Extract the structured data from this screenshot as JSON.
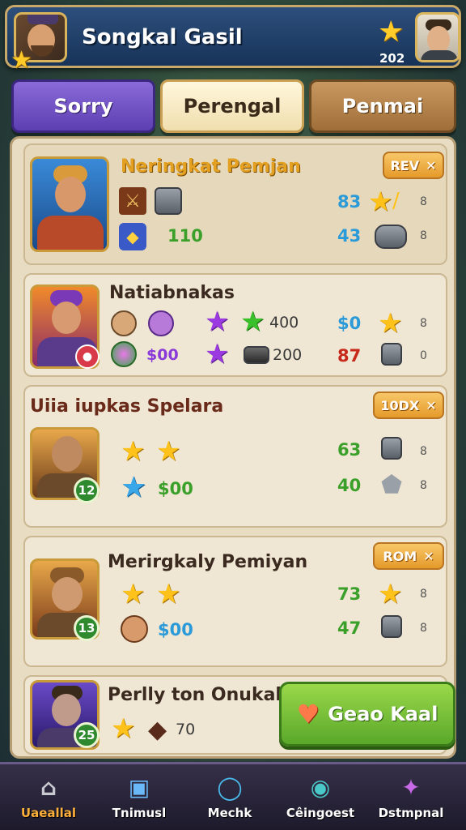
{
  "header": {
    "title": "Songkal Gasil",
    "star_count": "202",
    "star_icon": "star-icon"
  },
  "tabs": [
    {
      "label": "Sorry"
    },
    {
      "label": "Perengal"
    },
    {
      "label": "Penmai"
    }
  ],
  "cards": [
    {
      "title": "Neringkat Pemjan",
      "badge": "REV",
      "item_value": "110",
      "stats": [
        "83",
        "43"
      ],
      "side_values": [
        "8",
        "8"
      ]
    },
    {
      "title": "Natiabnakas",
      "values": [
        "400",
        "$00",
        "200"
      ],
      "stats": [
        "$0",
        "87"
      ],
      "side_values": [
        "8",
        "0"
      ]
    },
    {
      "title": "Uiia iupkas Spelara",
      "badge": "10DX",
      "level": "12",
      "value": "$00",
      "stats": [
        "63",
        "40"
      ],
      "side_values": [
        "8",
        "8"
      ]
    },
    {
      "title": "Merirgkaly Pemiyan",
      "badge": "ROM",
      "level": "13",
      "value": "$00",
      "stats": [
        "73",
        "47"
      ],
      "side_values": [
        "8",
        "8"
      ]
    },
    {
      "title": "Perlly ton Onukal",
      "level": "25",
      "value": "70",
      "button": "Geao Kaal"
    }
  ],
  "nav": [
    {
      "label": "Uaeallal",
      "icon": "home-icon"
    },
    {
      "label": "Tnimusl",
      "icon": "chest-icon"
    },
    {
      "label": "Mechk",
      "icon": "search-icon"
    },
    {
      "label": "Cêingoest",
      "icon": "compass-icon"
    },
    {
      "label": "Dstmpnal",
      "icon": "gems-icon"
    }
  ],
  "colors": {
    "header_bg": "#1f4068",
    "tab_active": "#f0deae",
    "tab_purple": "#6a4ac4",
    "tab_brown": "#b07a40",
    "panel_bg": "#e8dcc2",
    "button_green": "#7ac23a",
    "nav_active": "#ffb03a"
  }
}
